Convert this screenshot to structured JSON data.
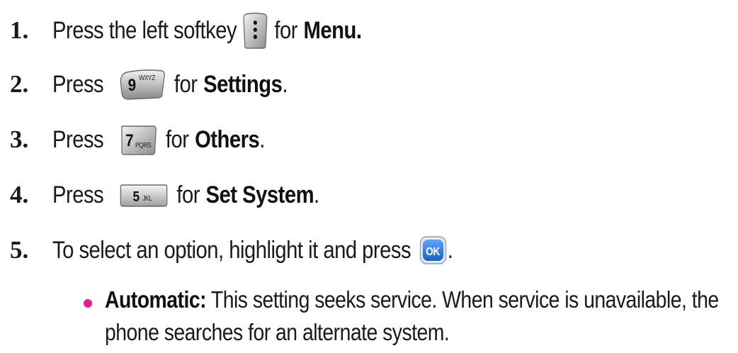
{
  "steps": [
    {
      "number": "1.",
      "before": "Press the left softkey",
      "key_icon": "left-softkey-icon",
      "after": "for",
      "target": "Menu.",
      "end": ""
    },
    {
      "number": "2.",
      "before": "Press",
      "key_icon": "key-9-wxyz-icon",
      "key_main": "9",
      "key_sub": "WXYZ",
      "after": "for",
      "target": "Settings",
      "end": "."
    },
    {
      "number": "3.",
      "before": "Press",
      "key_icon": "key-7-pqrs-icon",
      "key_main": "7",
      "key_sub": "PQRS",
      "after": "for",
      "target": "Others",
      "end": "."
    },
    {
      "number": "4.",
      "before": "Press",
      "key_icon": "key-5-jkl-icon",
      "key_main": "5",
      "key_sub": "JKL",
      "after": "for",
      "target": "Set System",
      "end": "."
    },
    {
      "number": "5.",
      "before": "To select an option, highlight it and press",
      "key_icon": "ok-key-icon",
      "key_main": "OK",
      "end": "."
    }
  ],
  "bullet": {
    "term": "Automatic:",
    "text": "This setting seeks service. When service is unavailable, the phone searches for an alternate system."
  },
  "colors": {
    "bullet": "#e91e8c",
    "ok_key": "#2f7fe0",
    "key_gray": "#9a9a9a"
  }
}
